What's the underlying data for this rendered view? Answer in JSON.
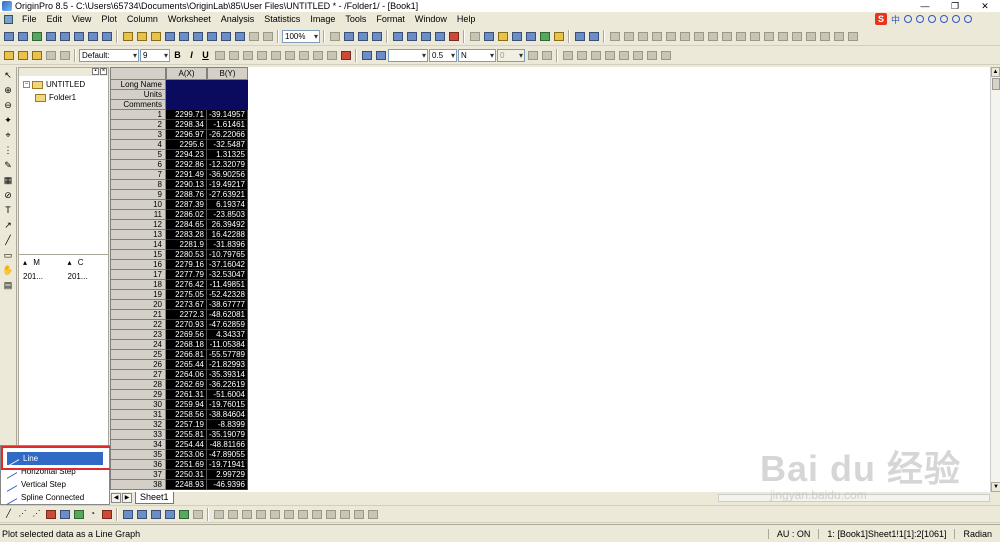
{
  "window": {
    "title": "OriginPro 8.5 - C:\\Users\\65734\\Documents\\OriginLab\\85\\User Files\\UNTITLED * - /Folder1/ - [Book1]",
    "min": "—",
    "max": "❐",
    "close": "✕"
  },
  "menu": [
    "File",
    "Edit",
    "View",
    "Plot",
    "Column",
    "Worksheet",
    "Analysis",
    "Statistics",
    "Image",
    "Tools",
    "Format",
    "Window",
    "Help"
  ],
  "ime": {
    "logo": "S",
    "lang": "中"
  },
  "toolbar1": {
    "zoom": "100%"
  },
  "toolbar2": {
    "font": "Default:",
    "size": "9",
    "bold": "B",
    "italic": "I",
    "underline": "U",
    "line_width": "0.5",
    "fill": "N",
    "num": "0"
  },
  "project": {
    "root": "UNTITLED",
    "folder": "Folder1",
    "col1": "M",
    "col2": "C",
    "row_val1": "201...",
    "row_val2": "201..."
  },
  "plot_menu": {
    "items": [
      "Line",
      "Horizontal Step",
      "Vertical Step",
      "Spline Connected"
    ],
    "selected": "Line"
  },
  "worksheet": {
    "col_a": "A(X)",
    "col_b": "B(Y)",
    "labels": [
      "Long Name",
      "Units",
      "Comments"
    ],
    "sheet_tab": "Sheet1",
    "rows": [
      [
        "1",
        "2299.71",
        "-39.14957"
      ],
      [
        "2",
        "2298.34",
        "-1.61461"
      ],
      [
        "3",
        "2296.97",
        "-26.22066"
      ],
      [
        "4",
        "2295.6",
        "-32.5487"
      ],
      [
        "5",
        "2294.23",
        "1.31325"
      ],
      [
        "6",
        "2292.86",
        "-12.32079"
      ],
      [
        "7",
        "2291.49",
        "-36.90256"
      ],
      [
        "8",
        "2290.13",
        "-19.49217"
      ],
      [
        "9",
        "2288.76",
        "-27.63921"
      ],
      [
        "10",
        "2287.39",
        "6.19374"
      ],
      [
        "11",
        "2286.02",
        "-23.8503"
      ],
      [
        "12",
        "2284.65",
        "26.39492"
      ],
      [
        "13",
        "2283.28",
        "16.42288"
      ],
      [
        "14",
        "2281.9",
        "-31.8396"
      ],
      [
        "15",
        "2280.53",
        "-10.79765"
      ],
      [
        "16",
        "2279.16",
        "-37.16042"
      ],
      [
        "17",
        "2277.79",
        "-32.53047"
      ],
      [
        "18",
        "2276.42",
        "-11.49851"
      ],
      [
        "19",
        "2275.05",
        "-52.42328"
      ],
      [
        "20",
        "2273.67",
        "-38.67777"
      ],
      [
        "21",
        "2272.3",
        "-48.62081"
      ],
      [
        "22",
        "2270.93",
        "-47.62859"
      ],
      [
        "23",
        "2269.56",
        "4.34337"
      ],
      [
        "24",
        "2268.18",
        "-11.05384"
      ],
      [
        "25",
        "2266.81",
        "-55.57789"
      ],
      [
        "26",
        "2265.44",
        "-21.82993"
      ],
      [
        "27",
        "2264.06",
        "-35.39314"
      ],
      [
        "28",
        "2262.69",
        "-36.22619"
      ],
      [
        "29",
        "2261.31",
        "-51.6004"
      ],
      [
        "30",
        "2259.94",
        "-19.76015"
      ],
      [
        "31",
        "2258.56",
        "-38.84604"
      ],
      [
        "32",
        "2257.19",
        "-8.8399"
      ],
      [
        "33",
        "2255.81",
        "-35.19079"
      ],
      [
        "34",
        "2254.44",
        "-48.81166"
      ],
      [
        "35",
        "2253.06",
        "-47.89055"
      ],
      [
        "36",
        "2251.69",
        "-19.71941"
      ],
      [
        "37",
        "2250.31",
        "2.99729"
      ],
      [
        "38",
        "2248.93",
        "-46.9396"
      ]
    ]
  },
  "status": {
    "message": "Plot selected data as a Line Graph",
    "au": "AU : ON",
    "ref": "1: [Book1]Sheet1!1[1]:2[1061]",
    "angle": "Radian"
  },
  "watermark": {
    "brand": "Bai du 经验",
    "url": "jingyan.baidu.com"
  }
}
